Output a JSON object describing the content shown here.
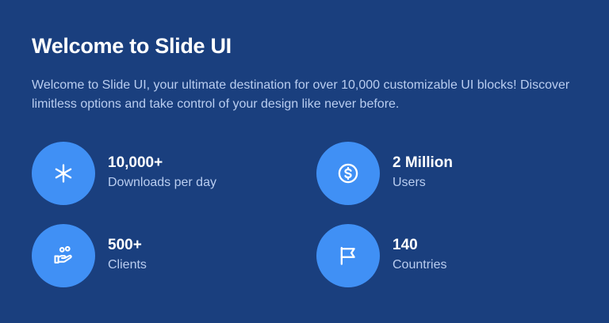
{
  "header": {
    "title": "Welcome to Slide UI",
    "description": "Welcome to Slide UI, your ultimate destination for over 10,000 customizable UI blocks! Discover limitless options and take control of your design like never before."
  },
  "stats": [
    {
      "icon": "asterisk-icon",
      "value": "10,000+",
      "label": "Downloads per day"
    },
    {
      "icon": "dollar-coin-icon",
      "value": "2 Million",
      "label": "Users"
    },
    {
      "icon": "hand-coins-icon",
      "value": "500+",
      "label": "Clients"
    },
    {
      "icon": "flag-icon",
      "value": "140",
      "label": "Countries"
    }
  ],
  "colors": {
    "background": "#1a3f7e",
    "icon_circle": "#4090f5",
    "text_primary": "#ffffff",
    "text_secondary": "#b9cdf0"
  }
}
